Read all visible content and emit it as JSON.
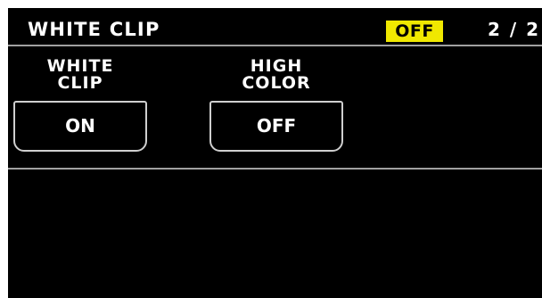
{
  "header": {
    "title": "WHITE CLIP",
    "status": "OFF",
    "page": "2 / 2"
  },
  "settings": [
    {
      "label_line1": "WHITE",
      "label_line2": "CLIP",
      "value": "ON"
    },
    {
      "label_line1": "HIGH",
      "label_line2": "COLOR",
      "value": "OFF"
    }
  ],
  "colors": {
    "background": "#000000",
    "status_highlight": "#f0e800",
    "divider": "#a0a0a0"
  }
}
